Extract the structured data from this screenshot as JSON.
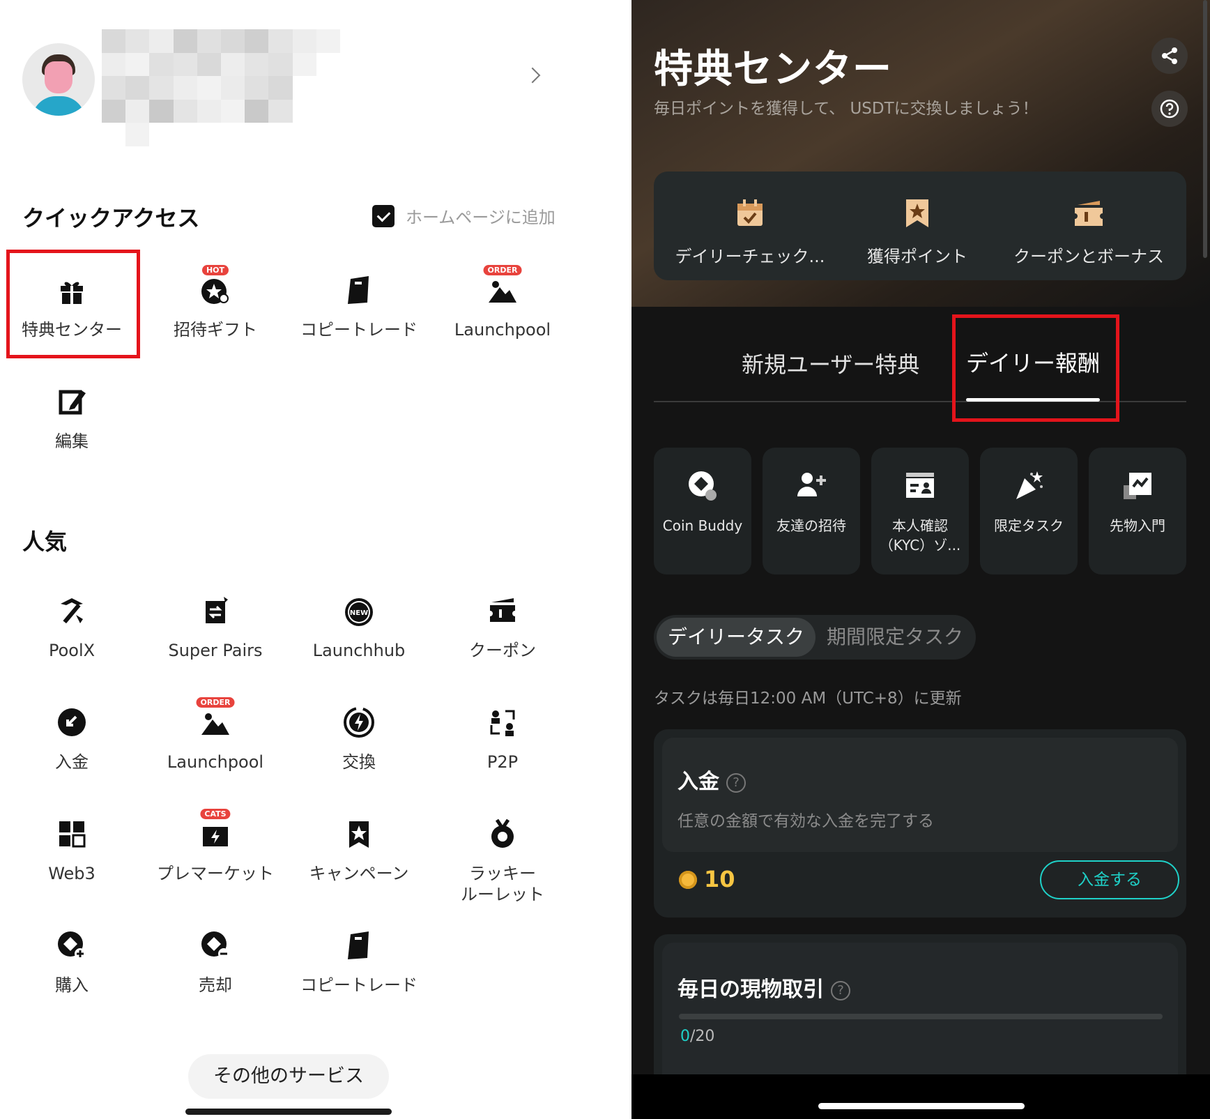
{
  "left": {
    "quick_access": {
      "title": "クイックアクセス",
      "add_to_home_label": "ホームページに追加",
      "items": [
        {
          "label": "特典センター",
          "icon": "gift-icon",
          "badge": ""
        },
        {
          "label": "招待ギフト",
          "icon": "invite-star-icon",
          "badge": "HOT"
        },
        {
          "label": "コピートレード",
          "icon": "copy-card-icon",
          "badge": ""
        },
        {
          "label": "Launchpool",
          "icon": "mountain-icon",
          "badge": "ORDER"
        },
        {
          "label": "編集",
          "icon": "edit-icon",
          "badge": ""
        }
      ]
    },
    "popular": {
      "title": "人気",
      "items": [
        {
          "label": "PoolX",
          "icon": "pickaxe-icon",
          "badge": ""
        },
        {
          "label": "Super Pairs",
          "icon": "pairs-icon",
          "badge": ""
        },
        {
          "label": "Launchhub",
          "icon": "new-icon",
          "badge": "NEW"
        },
        {
          "label": "クーポン",
          "icon": "ticket-icon",
          "badge": ""
        },
        {
          "label": "入金",
          "icon": "deposit-icon",
          "badge": ""
        },
        {
          "label": "Launchpool",
          "icon": "mountain-icon",
          "badge": "ORDER"
        },
        {
          "label": "交換",
          "icon": "convert-icon",
          "badge": ""
        },
        {
          "label": "P2P",
          "icon": "p2p-icon",
          "badge": ""
        },
        {
          "label": "Web3",
          "icon": "web3-icon",
          "badge": ""
        },
        {
          "label": "プレマーケット",
          "icon": "premarket-icon",
          "badge": "CATS"
        },
        {
          "label": "キャンペーン",
          "icon": "campaign-flag-icon",
          "badge": ""
        },
        {
          "label": "ラッキールーレット",
          "label_line1": "ラッキー",
          "label_line2": "ルーレット",
          "icon": "medal-icon",
          "badge": ""
        },
        {
          "label": "購入",
          "icon": "buy-coin-icon",
          "badge": ""
        },
        {
          "label": "売却",
          "icon": "sell-coin-icon",
          "badge": ""
        },
        {
          "label": "コピートレード",
          "icon": "copy-card-icon",
          "badge": ""
        }
      ]
    },
    "more_services_label": "その他のサービス"
  },
  "right": {
    "title": "特典センター",
    "subtitle": "毎日ポイントを獲得して、 USDTに交換しましょう！",
    "features": [
      {
        "label": "デイリーチェック...",
        "icon": "calendar-check-icon"
      },
      {
        "label": "獲得ポイント",
        "icon": "bookmark-star-icon"
      },
      {
        "label": "クーポンとボーナス",
        "icon": "coupon-icon"
      }
    ],
    "tabs": [
      {
        "label": "新規ユーザー特典",
        "active": false
      },
      {
        "label": "デイリー報酬",
        "active": true
      }
    ],
    "task_tiles": [
      {
        "label": "Coin Buddy",
        "icon": "coin-buddy-icon"
      },
      {
        "label": "友達の招待",
        "icon": "add-friend-icon"
      },
      {
        "label_line1": "本人確認",
        "label_line2": "（KYC）ゾ...",
        "icon": "id-card-icon"
      },
      {
        "label": "限定タスク",
        "icon": "party-popper-icon"
      },
      {
        "label": "先物入門",
        "icon": "futures-chart-icon"
      }
    ],
    "segments": {
      "active": "デイリータスク",
      "inactive": "期間限定タスク"
    },
    "update_note": "タスクは毎日12:00 AM（UTC+8）に更新",
    "tasks": [
      {
        "name": "入金",
        "desc": "任意の金額で有効な入金を完了する",
        "reward": "10",
        "button": "入金する"
      },
      {
        "name": "毎日の現物取引",
        "progress_current": "0",
        "progress_total": "/20",
        "progress": 0
      }
    ]
  },
  "colors": {
    "highlight": "#e4141b",
    "accent_teal": "#1fd1c8",
    "reward_gold": "#f6c542",
    "badge_red": "#e8433d"
  }
}
